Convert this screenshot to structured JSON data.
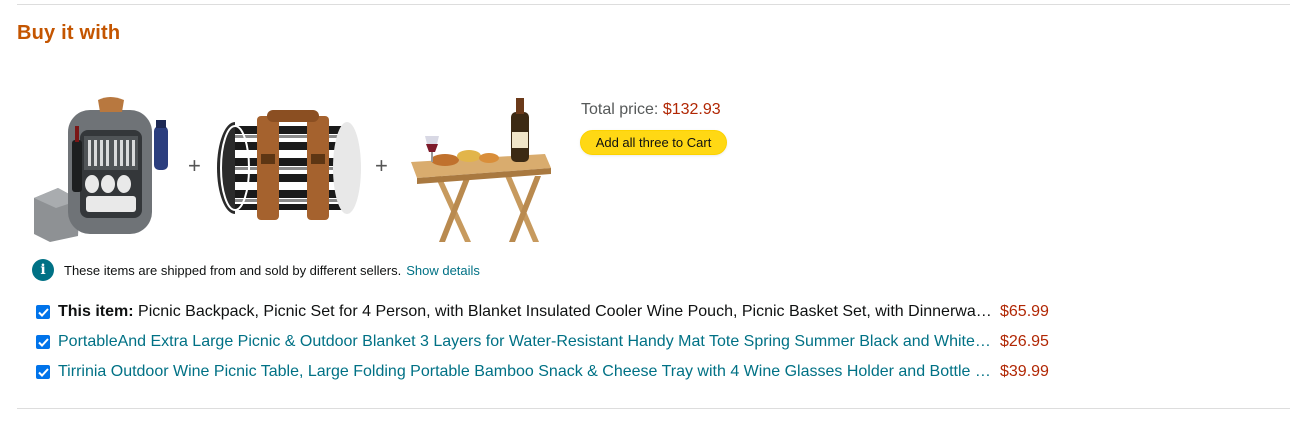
{
  "section": {
    "heading": "Buy it with"
  },
  "summary": {
    "total_label": "Total price:",
    "total_price": "$132.93",
    "add_button": "Add all three to Cart"
  },
  "products_images": [
    {
      "name": "picnic-backpack-image"
    },
    {
      "name": "picnic-blanket-image"
    },
    {
      "name": "wine-table-image"
    }
  ],
  "plus_sign": "+",
  "notice": {
    "icon": "info-icon",
    "icon_glyph": "i",
    "text": "These items are shipped from and sold by different sellers.",
    "link": "Show details"
  },
  "items": [
    {
      "prefix": "This item:",
      "title": "Picnic Backpack, Picnic Set for 4 Person, with Blanket Insulated Cooler Wine Pouch, Picnic Basket Set, with Dinnerware for Camping, Outdoor",
      "price": "$65.99",
      "checked": true
    },
    {
      "prefix": "",
      "title": "PortableAnd Extra Large Picnic & Outdoor Blanket 3 Layers for Water-Resistant Handy Mat Tote Spring Summer Black and White Stripes",
      "price": "$26.95",
      "checked": true
    },
    {
      "prefix": "",
      "title": "Tirrinia Outdoor Wine Picnic Table, Large Folding Portable Bamboo Snack & Cheese Tray with 4 Wine Glasses Holder and Bottle Rack",
      "price": "$39.99",
      "checked": true
    }
  ],
  "colors": {
    "heading": "#c45500",
    "price": "#b12704",
    "link": "#007185",
    "button": "#ffd814",
    "checkbox": "#0073ea"
  }
}
